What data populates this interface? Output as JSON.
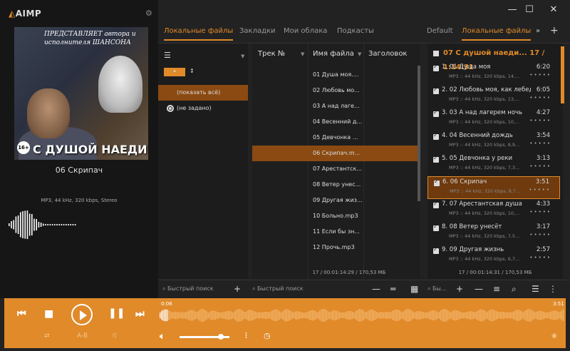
{
  "app": {
    "logo": "AIMP"
  },
  "now_playing": {
    "cover_text_top": "ПРЕДСТАВЛЯЕТ автора и исполнителя ШАНСОНА",
    "cover_title": "С ДУШОЙ НАЕДИНЕ",
    "cover_badge": "16+",
    "title": "06 Скрипач",
    "info": "MP3, 44 kHz, 320 kbps, Stereo"
  },
  "tabs_left": [
    {
      "label": "Локальные файлы",
      "active": true
    },
    {
      "label": "Закладки",
      "active": false
    },
    {
      "label": "Мои облака",
      "active": false
    },
    {
      "label": "Подкасты",
      "active": false
    }
  ],
  "tabs_right": [
    {
      "label": "Default",
      "active": false
    },
    {
      "label": "Локальные файлы",
      "active": true
    }
  ],
  "filters": {
    "pill": "*",
    "items": [
      "(показать всё)",
      "(не задано)"
    ]
  },
  "grid": {
    "columns": [
      "Трек №",
      "Имя файла",
      "Заголовок"
    ],
    "rows": [
      "01 Душа моя....",
      "02 Любовь мо...",
      "03 А над лаге...",
      "04 Весенний д...",
      "05 Девчонка ...",
      "06 Скрипач.m...",
      "07 Арестантск...",
      "08 Ветер унес...",
      "09 Другая жиз...",
      "10 Больно.mp3",
      "11 Если бы зн...",
      "12 Прочь.mp3"
    ],
    "selected": 5,
    "status": "17 / 00:01:14:29 / 170,53 МБ"
  },
  "playlist": {
    "header": "07 С душой наеди... 17 / 1:14:31",
    "items": [
      {
        "name": "1. 01 Душа моя",
        "dur": "6:20",
        "meta": "MP3 :: 44 kHz, 320 kbps, 14,..."
      },
      {
        "name": "2. 02 Любовь моя, как лебеди",
        "dur": "6:05",
        "meta": "MP3 :: 44 kHz, 320 kbps, 13,..."
      },
      {
        "name": "3. 03 А над лагерем ночь",
        "dur": "4:27",
        "meta": "MP3 :: 44 kHz, 320 kbps, 10,..."
      },
      {
        "name": "4. 04 Весенний дождь",
        "dur": "3:54",
        "meta": "MP3 :: 44 kHz, 320 kbps, 8,9..."
      },
      {
        "name": "5. 05 Девчонка у реки",
        "dur": "3:13",
        "meta": "MP3 :: 44 kHz, 320 kbps, 7,3..."
      },
      {
        "name": "6. 06 Скрипач",
        "dur": "3:51",
        "meta": "MP3 :: 44 kHz, 320 kbps, 8,7..."
      },
      {
        "name": "7. 07 Арестантская душа",
        "dur": "4:33",
        "meta": "MP3 :: 44 kHz, 320 kbps, 10,..."
      },
      {
        "name": "8. 08 Ветер унесёт",
        "dur": "3:17",
        "meta": "MP3 :: 44 kHz, 320 kbps, 7,5..."
      },
      {
        "name": "9. 09 Другая жизнь",
        "dur": "2:57",
        "meta": "MP3 :: 44 kHz, 320 kbps, 6,7..."
      }
    ],
    "selected": 5,
    "status": "17 / 00:01:14:31 / 170,53 МБ"
  },
  "search": {
    "placeholder": "Быстрый поиск",
    "short": "Бы..."
  },
  "player": {
    "time_elapsed": "0:06",
    "time_total": "3:51",
    "ab_label": "A-B",
    "volume": 0.77
  },
  "colors": {
    "accent": "#e08a2a",
    "selection": "#8a4a12"
  }
}
